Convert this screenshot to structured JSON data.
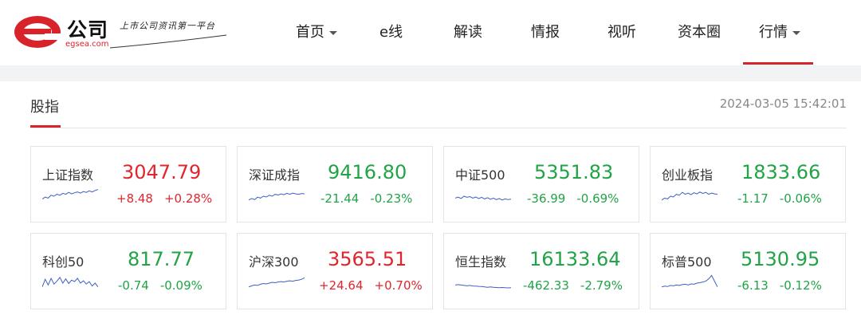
{
  "brand": {
    "name": "公司",
    "url": "egsea.com",
    "slogan": "上市公司资讯第一平台",
    "accent": "#d9232a"
  },
  "nav": [
    {
      "label": "首页",
      "dropdown": true,
      "active": false
    },
    {
      "label": "e线",
      "dropdown": false,
      "active": false
    },
    {
      "label": "解读",
      "dropdown": false,
      "active": false
    },
    {
      "label": "情报",
      "dropdown": false,
      "active": false
    },
    {
      "label": "视听",
      "dropdown": false,
      "active": false
    },
    {
      "label": "资本圈",
      "dropdown": false,
      "active": false
    },
    {
      "label": "行情",
      "dropdown": true,
      "active": true
    }
  ],
  "section": {
    "title": "股指",
    "timestamp": "2024-03-05 15:42:01"
  },
  "colors": {
    "up": "#e0262d",
    "down": "#21a347",
    "spark": "#3d5fc4"
  },
  "indices": [
    {
      "name": "上证指数",
      "value": "3047.79",
      "change": "+8.48",
      "pct": "+0.28%",
      "dir": "up",
      "spark": [
        0.35,
        0.45,
        0.4,
        0.55,
        0.5,
        0.6,
        0.55,
        0.65,
        0.6,
        0.7,
        0.62,
        0.68,
        0.72,
        0.66,
        0.74,
        0.7,
        0.78,
        0.72,
        0.8,
        0.85
      ]
    },
    {
      "name": "深证成指",
      "value": "9416.80",
      "change": "-21.44",
      "pct": "-0.23%",
      "dir": "down",
      "spark": [
        0.3,
        0.38,
        0.32,
        0.45,
        0.4,
        0.5,
        0.46,
        0.55,
        0.5,
        0.6,
        0.56,
        0.62,
        0.58,
        0.65,
        0.6,
        0.66,
        0.62,
        0.6,
        0.64,
        0.62
      ]
    },
    {
      "name": "中证500",
      "value": "5351.83",
      "change": "-36.99",
      "pct": "-0.69%",
      "dir": "down",
      "spark": [
        0.4,
        0.45,
        0.38,
        0.5,
        0.44,
        0.48,
        0.4,
        0.46,
        0.38,
        0.44,
        0.36,
        0.42,
        0.34,
        0.4,
        0.32,
        0.38,
        0.3,
        0.36,
        0.32,
        0.34
      ]
    },
    {
      "name": "创业板指",
      "value": "1833.66",
      "change": "-1.17",
      "pct": "-0.06%",
      "dir": "down",
      "spark": [
        0.3,
        0.4,
        0.36,
        0.5,
        0.46,
        0.6,
        0.55,
        0.7,
        0.6,
        0.66,
        0.58,
        0.68,
        0.62,
        0.72,
        0.64,
        0.7,
        0.6,
        0.66,
        0.62,
        0.6
      ]
    },
    {
      "name": "科创50",
      "value": "817.77",
      "change": "-0.74",
      "pct": "-0.09%",
      "dir": "down",
      "spark": [
        0.3,
        0.7,
        0.4,
        0.75,
        0.45,
        0.6,
        0.8,
        0.5,
        0.72,
        0.48,
        0.66,
        0.58,
        0.75,
        0.5,
        0.62,
        0.45,
        0.58,
        0.35,
        0.5,
        0.3
      ]
    },
    {
      "name": "沪深300",
      "value": "3565.51",
      "change": "+24.64",
      "pct": "+0.70%",
      "dir": "up",
      "spark": [
        0.3,
        0.36,
        0.4,
        0.38,
        0.44,
        0.48,
        0.46,
        0.5,
        0.54,
        0.52,
        0.56,
        0.58,
        0.56,
        0.6,
        0.62,
        0.6,
        0.64,
        0.66,
        0.7,
        0.78
      ]
    },
    {
      "name": "恒生指数",
      "value": "16133.64",
      "change": "-462.33",
      "pct": "-2.79%",
      "dir": "down",
      "spark": [
        0.4,
        0.42,
        0.4,
        0.38,
        0.36,
        0.38,
        0.35,
        0.34,
        0.33,
        0.32,
        0.3,
        0.28,
        0.3,
        0.28,
        0.27,
        0.26,
        0.27,
        0.26,
        0.25,
        0.26
      ]
    },
    {
      "name": "标普500",
      "value": "5130.95",
      "change": "-6.13",
      "pct": "-0.12%",
      "dir": "down",
      "spark": [
        0.3,
        0.34,
        0.32,
        0.38,
        0.36,
        0.4,
        0.38,
        0.42,
        0.44,
        0.4,
        0.46,
        0.44,
        0.5,
        0.52,
        0.56,
        0.6,
        0.72,
        0.9,
        0.6,
        0.3
      ]
    }
  ]
}
